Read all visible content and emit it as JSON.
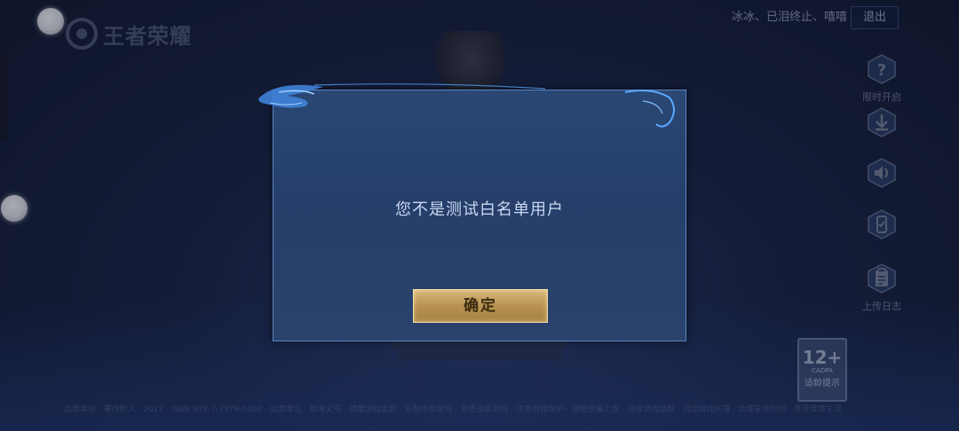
{
  "game": {
    "logo_text": "王者荣耀"
  },
  "topbar": {
    "user_text": "冰冰、已泪终止、嘻嘻",
    "logout_label": "退出"
  },
  "right_panel": {
    "items": [
      {
        "icon": "question-icon",
        "label": "限时开启"
      },
      {
        "icon": "download-icon",
        "label": ""
      },
      {
        "icon": "speaker-icon",
        "label": ""
      },
      {
        "icon": "phone-icon",
        "label": ""
      },
      {
        "icon": "clipboard-icon",
        "label": "上传日志"
      }
    ]
  },
  "age_rating": {
    "age": "12+",
    "org": "CADPA",
    "hint": "适龄提示"
  },
  "footer": {
    "text": "出版单位 · 著作权人 · 2017 · ISBN 978-7-7979-0000 · 运营单位 · 批准文号 · 健康游戏忠告 · 抵制不良游戏 · 拒绝盗版游戏 · 注意自我保护 · 谨防受骗上当 · 适度游戏益脑 · 沉迷游戏伤身 · 合理安排时间 · 享受健康生活"
  },
  "dialog": {
    "message": "您不是测试白名单用户",
    "confirm_label": "确定"
  }
}
